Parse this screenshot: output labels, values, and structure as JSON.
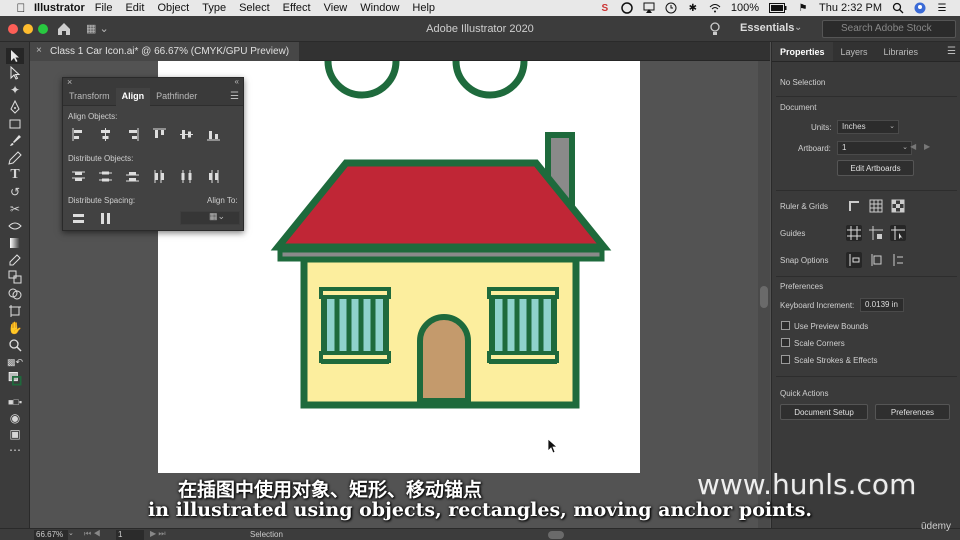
{
  "menubar": {
    "app_name": "Illustrator",
    "menus": [
      "File",
      "Edit",
      "Object",
      "Type",
      "Select",
      "Effect",
      "View",
      "Window",
      "Help"
    ],
    "battery": "100%",
    "time": "Thu 2:32 PM"
  },
  "titlebar": {
    "title": "Adobe Illustrator 2020",
    "workspace": "Essentials",
    "search_placeholder": "Search Adobe Stock"
  },
  "document_tab": {
    "label": "Class 1 Car Icon.ai* @ 66.67% (CMYK/GPU Preview)"
  },
  "align_panel": {
    "tabs": [
      "Transform",
      "Align",
      "Pathfinder"
    ],
    "active_tab": "Align",
    "sections": {
      "align_objects": "Align Objects:",
      "distribute_objects": "Distribute Objects:",
      "distribute_spacing": "Distribute Spacing:",
      "align_to": "Align To:"
    }
  },
  "properties": {
    "tabs": [
      "Properties",
      "Layers",
      "Libraries"
    ],
    "active_tab": "Properties",
    "selection": "No Selection",
    "document_header": "Document",
    "units_label": "Units:",
    "units_value": "Inches",
    "artboard_label": "Artboard:",
    "artboard_value": "1",
    "edit_artboards": "Edit Artboards",
    "ruler_grids": "Ruler & Grids",
    "guides": "Guides",
    "snap_options": "Snap Options",
    "preferences_header": "Preferences",
    "keyboard_increment_label": "Keyboard Increment:",
    "keyboard_increment_value": "0.0139 in",
    "checkboxes": [
      "Use Preview Bounds",
      "Scale Corners",
      "Scale Strokes & Effects"
    ],
    "quick_actions": "Quick Actions",
    "document_setup": "Document Setup",
    "preferences_button": "Preferences"
  },
  "statusbar": {
    "zoom": "66.67%",
    "artboard_number": "1",
    "tool": "Selection"
  },
  "overlay": {
    "subtitle_zh": "在插图中使用对象、矩形、移动锚点",
    "subtitle_en": "in illustrated using objects, rectangles, moving anchor points.",
    "watermark": "www.hunls.com",
    "udemy": "ūdemy"
  },
  "colors": {
    "roof_red": "#c02636",
    "house_green": "#1e6a3c",
    "wall_yellow": "#fcee9e",
    "door_brown": "#c49a6c",
    "window_teal": "#8fd2cc",
    "chimney_gray": "#8a8a8a"
  }
}
